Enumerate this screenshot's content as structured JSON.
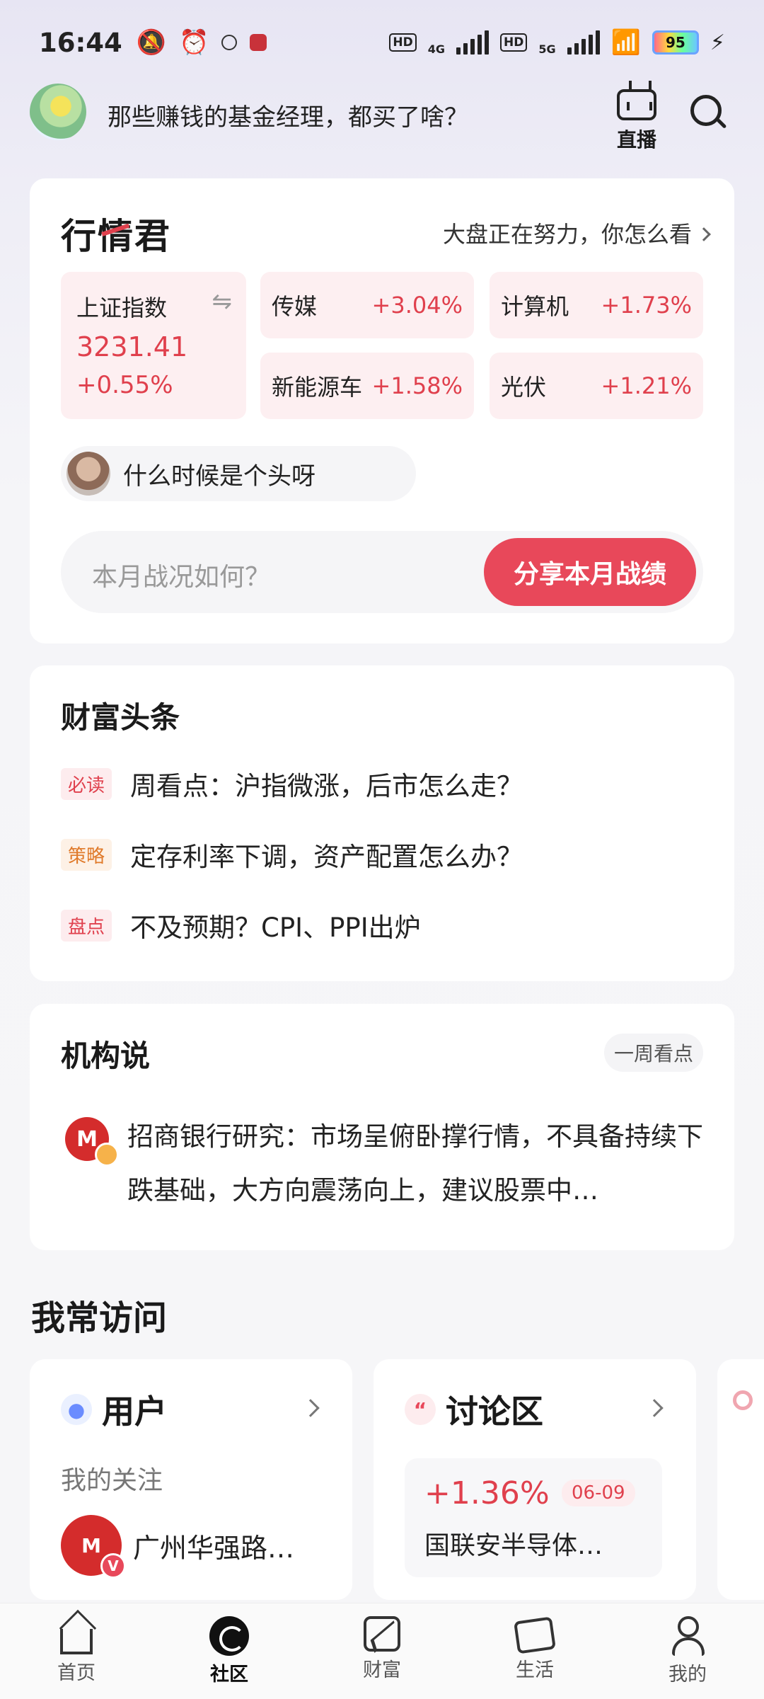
{
  "status_bar": {
    "time": "16:44",
    "battery": "95",
    "net1": "4G",
    "net2": "5G",
    "hd": "HD"
  },
  "header": {
    "headline": "那些赚钱的基金经理，都买了啥？",
    "live_label": "直播"
  },
  "market": {
    "title": "行情君",
    "more_text": "大盘正在努力，你怎么看",
    "index": {
      "name": "上证指数",
      "value": "3231.41",
      "change": "+0.55%"
    },
    "sectors": [
      {
        "name": "传媒",
        "change": "+3.04%"
      },
      {
        "name": "计算机",
        "change": "+1.73%"
      },
      {
        "name": "新能源车",
        "change": "+1.58%"
      },
      {
        "name": "光伏",
        "change": "+1.21%"
      }
    ],
    "user_comment": "什么时候是个头呀",
    "share_placeholder": "本月战况如何？",
    "share_button": "分享本月战绩"
  },
  "headlines": {
    "title": "财富头条",
    "items": [
      {
        "tag": "必读",
        "text": "周看点：沪指微涨，后市怎么走？",
        "tag_color": "#e0404d"
      },
      {
        "tag": "策略",
        "text": "定存利率下调，资产配置怎么办？",
        "tag_color": "#e07a2a"
      },
      {
        "tag": "盘点",
        "text": "不及预期？CPI、PPI出炉",
        "tag_color": "#e0404d"
      }
    ]
  },
  "institution": {
    "title": "机构说",
    "filter": "一周看点",
    "text": "招商银行研究：市场呈俯卧撑行情，不具备持续下跌基础，大方向震荡向上，建议股票中…"
  },
  "frequent": {
    "title": "我常访问",
    "user_card": {
      "title": "用户",
      "subtitle": "我的关注",
      "follow_name": "广州华强路…"
    },
    "discuss_card": {
      "title": "讨论区",
      "change": "+1.36%",
      "date": "06-09",
      "name": "国联安半导体…"
    }
  },
  "bottom_nav": [
    {
      "label": "首页",
      "icon": "home-icon"
    },
    {
      "label": "社区",
      "icon": "community-icon"
    },
    {
      "label": "财富",
      "icon": "wealth-icon"
    },
    {
      "label": "生活",
      "icon": "life-icon"
    },
    {
      "label": "我的",
      "icon": "profile-icon"
    }
  ],
  "colors": {
    "accent_red": "#e8485a",
    "rise": "#e0404d"
  }
}
